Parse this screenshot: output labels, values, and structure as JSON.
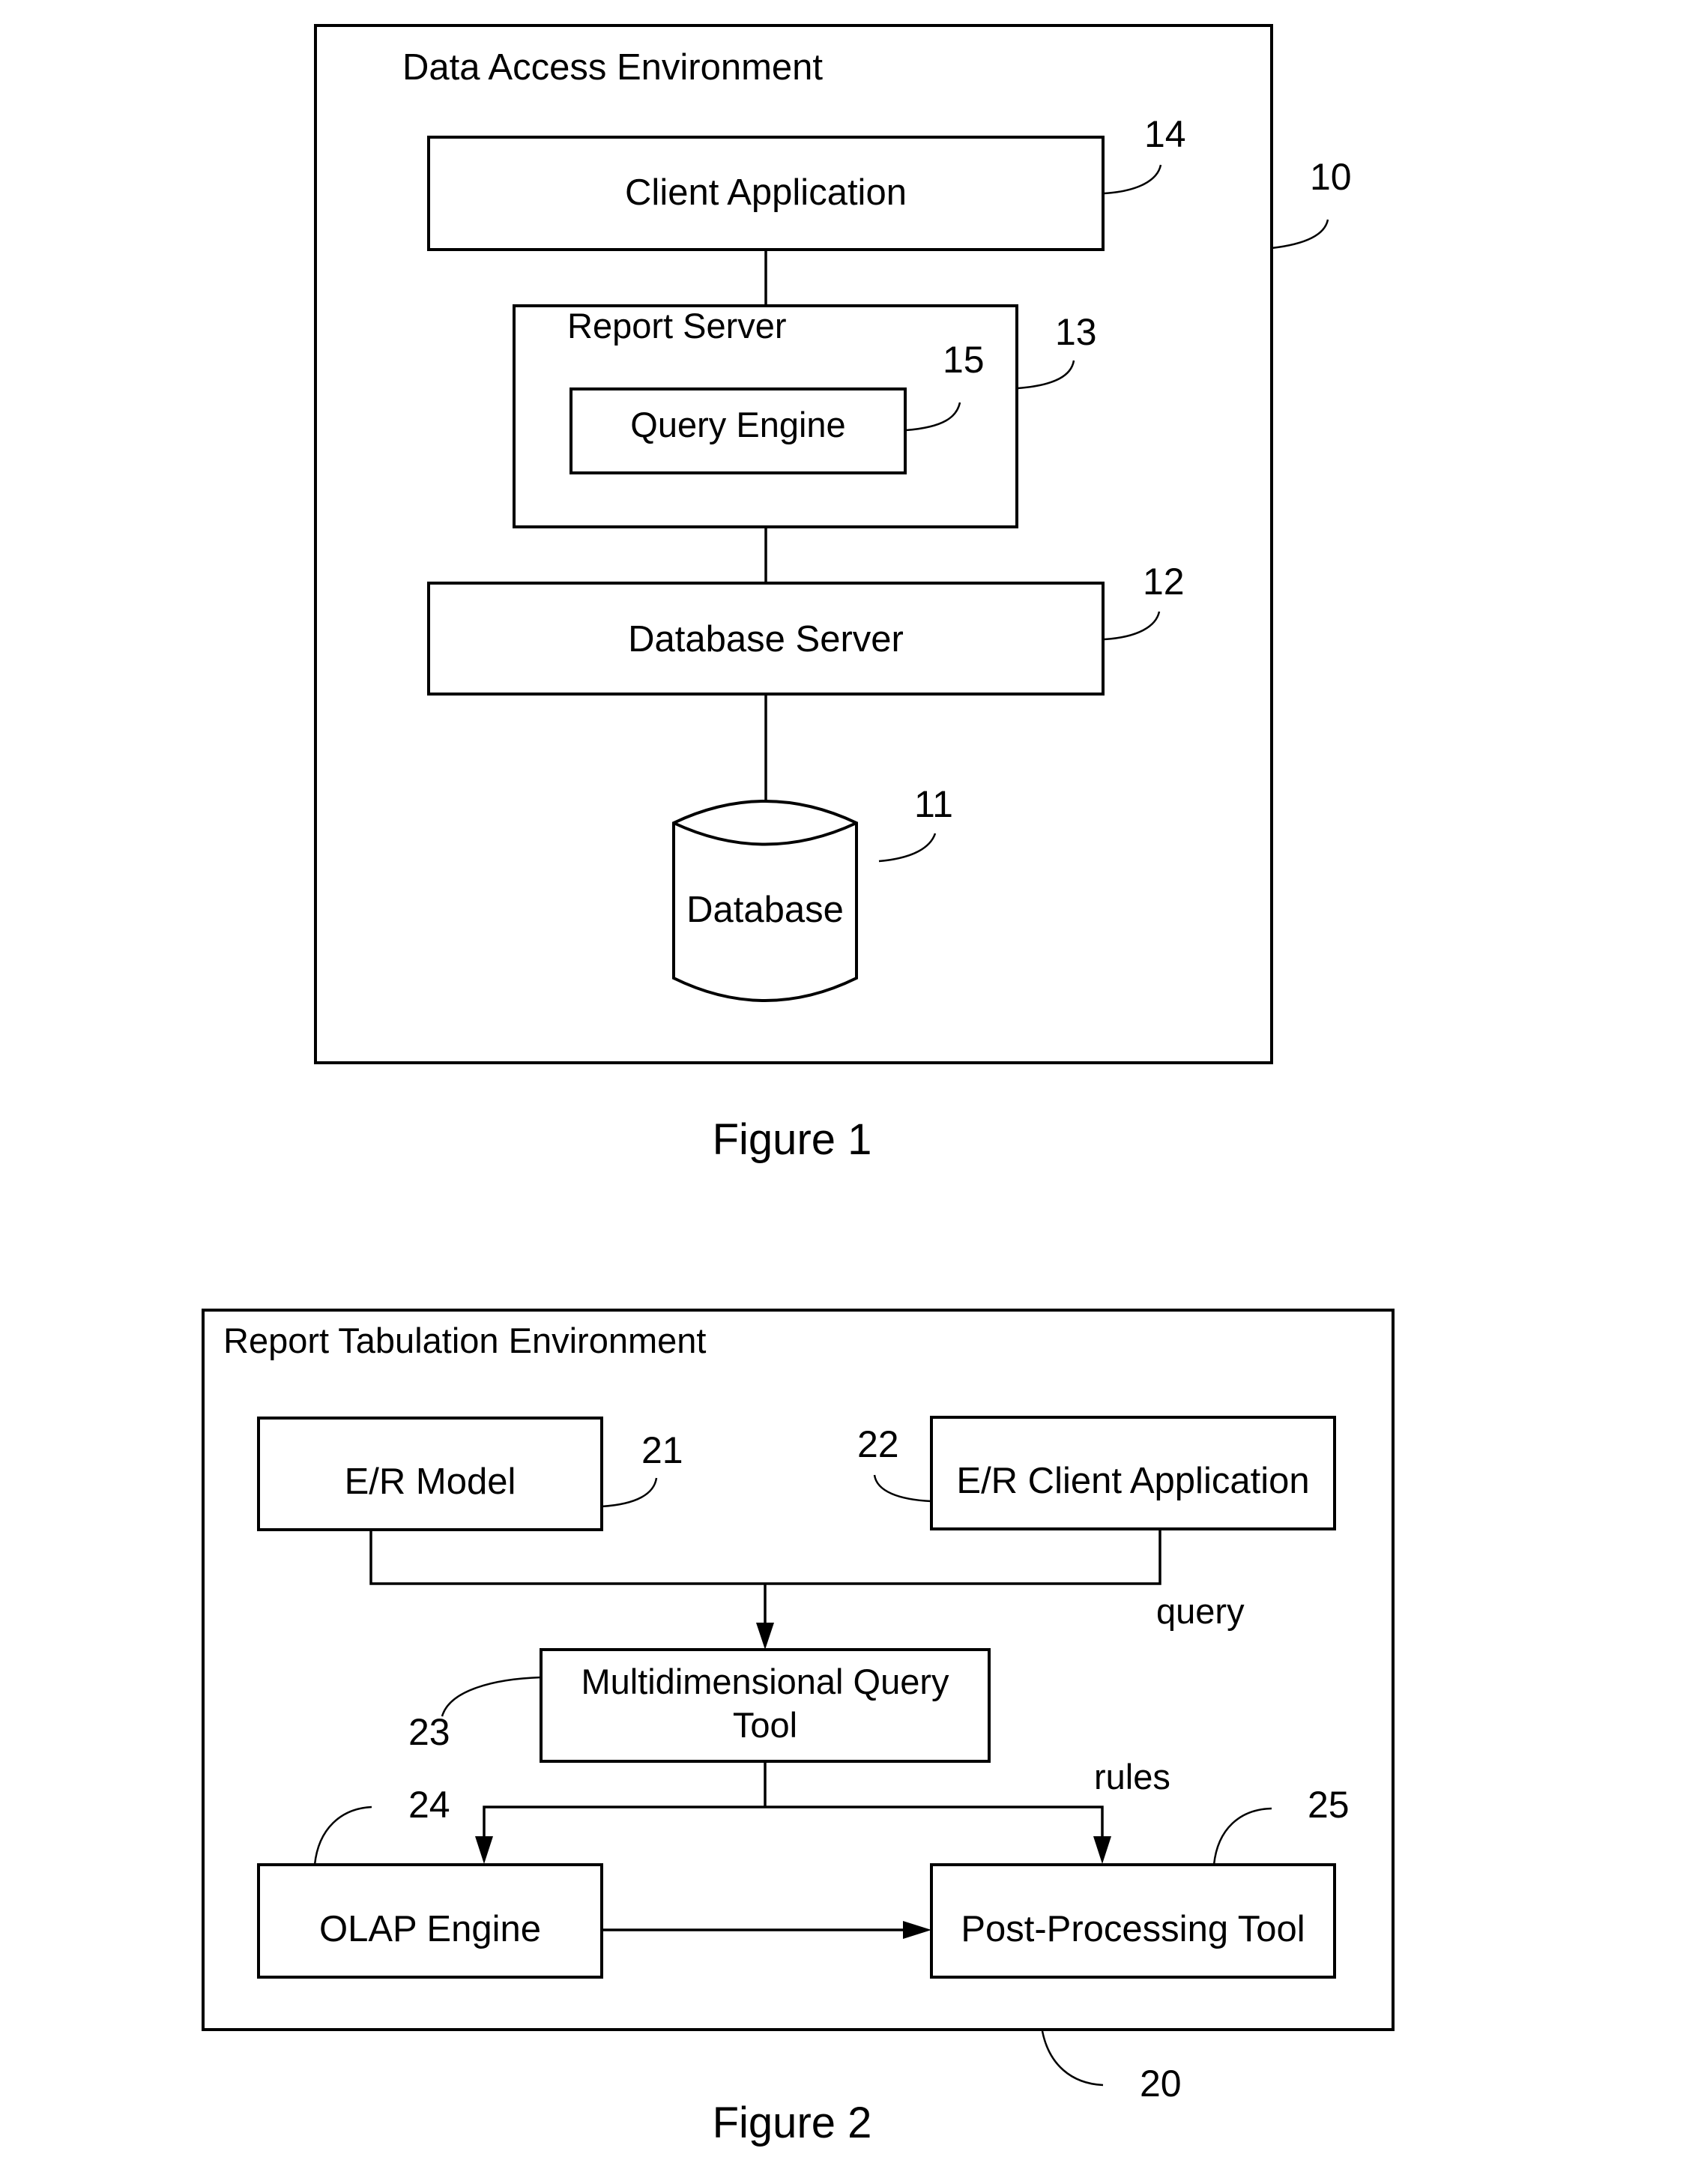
{
  "figure1": {
    "caption": "Figure 1",
    "environment": {
      "label": "Data Access Environment",
      "ref": "10"
    },
    "components": {
      "client_application": {
        "label": "Client Application",
        "ref": "14"
      },
      "report_server": {
        "label": "Report Server",
        "ref": "13"
      },
      "query_engine": {
        "label": "Query Engine",
        "ref": "15"
      },
      "database_server": {
        "label": "Database Server",
        "ref": "12"
      },
      "database": {
        "label": "Database",
        "ref": "11"
      }
    },
    "connections": [
      [
        "client_application",
        "report_server"
      ],
      [
        "report_server",
        "database_server"
      ],
      [
        "database_server",
        "database"
      ]
    ]
  },
  "figure2": {
    "caption": "Figure 2",
    "environment": {
      "label": "Report Tabulation Environment",
      "ref": "20"
    },
    "components": {
      "er_model": {
        "label": "E/R Model",
        "ref": "21"
      },
      "er_client_application": {
        "label": "E/R Client Application",
        "ref": "22"
      },
      "multidimensional_query_tool": {
        "label_line1": "Multidimensional Query",
        "label_line2": "Tool",
        "ref": "23"
      },
      "olap_engine": {
        "label": "OLAP Engine",
        "ref": "24"
      },
      "post_processing_tool": {
        "label": "Post-Processing Tool",
        "ref": "25"
      }
    },
    "edge_labels": {
      "query": "query",
      "rules": "rules"
    },
    "connections": [
      [
        "er_model",
        "multidimensional_query_tool"
      ],
      [
        "er_client_application",
        "multidimensional_query_tool"
      ],
      [
        "multidimensional_query_tool",
        "olap_engine"
      ],
      [
        "multidimensional_query_tool",
        "post_processing_tool"
      ],
      [
        "olap_engine",
        "post_processing_tool"
      ]
    ]
  }
}
